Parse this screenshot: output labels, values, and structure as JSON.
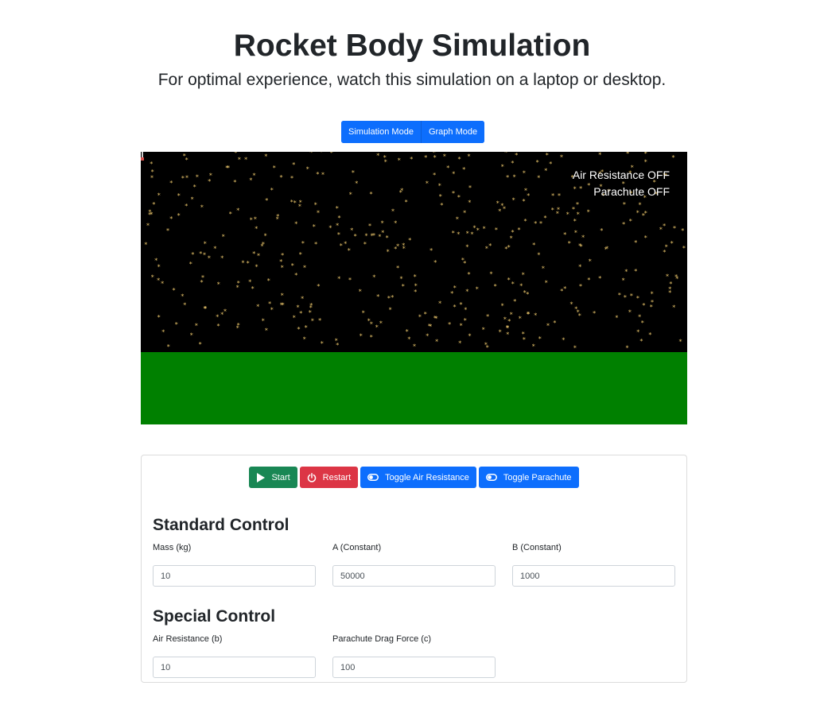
{
  "header": {
    "title": "Rocket Body Simulation",
    "subtitle": "For optimal experience, watch this simulation on a laptop or desktop."
  },
  "modes": {
    "simulation_label": "Simulation Mode",
    "graph_label": "Graph Mode"
  },
  "simulation": {
    "air_resistance_status": "Air Resistance OFF",
    "parachute_status": "Parachute OFF",
    "sky_color": "#000000",
    "ground_color": "#008000",
    "star_color": "#e8c46a"
  },
  "controls": {
    "start_label": "Start",
    "restart_label": "Restart",
    "toggle_air_label": "Toggle Air Resistance",
    "toggle_parachute_label": "Toggle Parachute",
    "icons": [
      "play-icon",
      "power-icon",
      "toggle-icon",
      "toggle-icon"
    ]
  },
  "standard_control": {
    "heading": "Standard Control",
    "mass": {
      "label": "Mass (kg)",
      "value": "10"
    },
    "a": {
      "label": "A (Constant)",
      "value": "50000"
    },
    "b": {
      "label": "B (Constant)",
      "value": "1000"
    }
  },
  "special_control": {
    "heading": "Special Control",
    "air_resistance": {
      "label": "Air Resistance (b)",
      "value": "10"
    },
    "parachute_drag": {
      "label": "Parachute Drag Force (c)",
      "value": "100"
    }
  }
}
